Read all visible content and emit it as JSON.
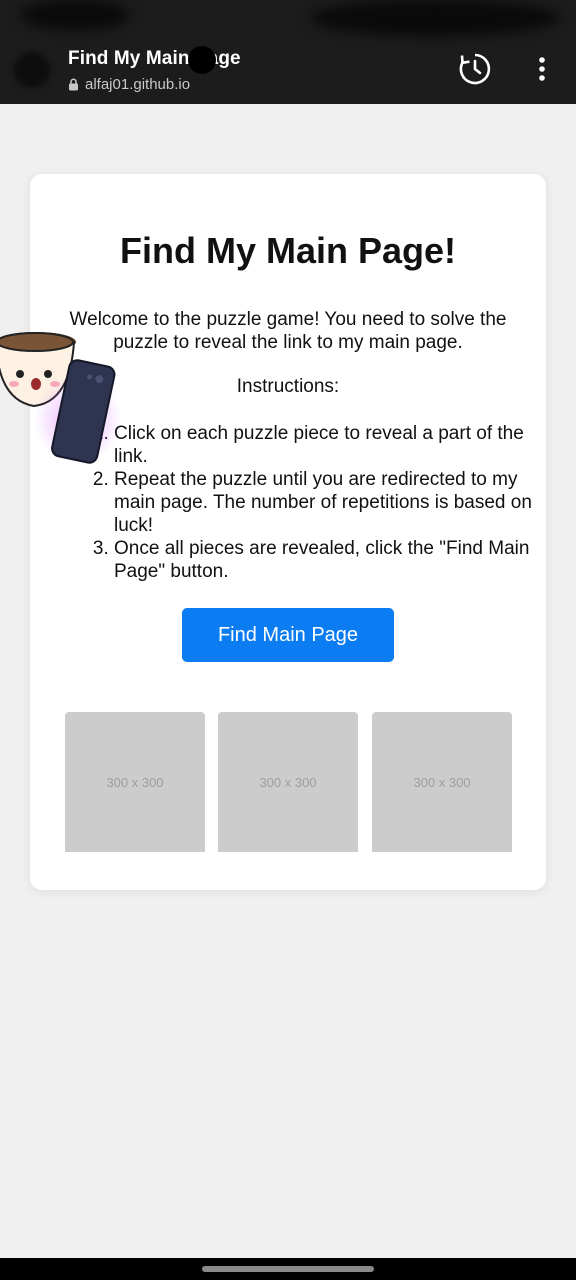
{
  "browser": {
    "tab_title": "Find My Main Page",
    "url": "alfaj01.github.io",
    "icons": {
      "lock": "lock-icon",
      "history": "history-icon",
      "more": "more-vert-icon"
    }
  },
  "page": {
    "title": "Find My Main Page!",
    "welcome": "Welcome to the puzzle game! You need to solve the puzzle to reveal the link to my main page.",
    "instructions_heading": "Instructions:",
    "steps": [
      "Click on each puzzle piece to reveal a part of the link.",
      "Repeat the puzzle until you are redirected to my main page. The number of repetitions is based on luck!",
      "Once all pieces are revealed, click the \"Find Main Page\" button."
    ],
    "button_label": "Find Main Page",
    "pieces": [
      {
        "label": "300 x 300"
      },
      {
        "label": "300 x 300"
      },
      {
        "label": "300 x 300"
      }
    ]
  },
  "colors": {
    "accent": "#0b7cf2",
    "background": "#f0f0f0",
    "topbar": "#1c1c1c",
    "piece_placeholder": "#cccccc"
  }
}
